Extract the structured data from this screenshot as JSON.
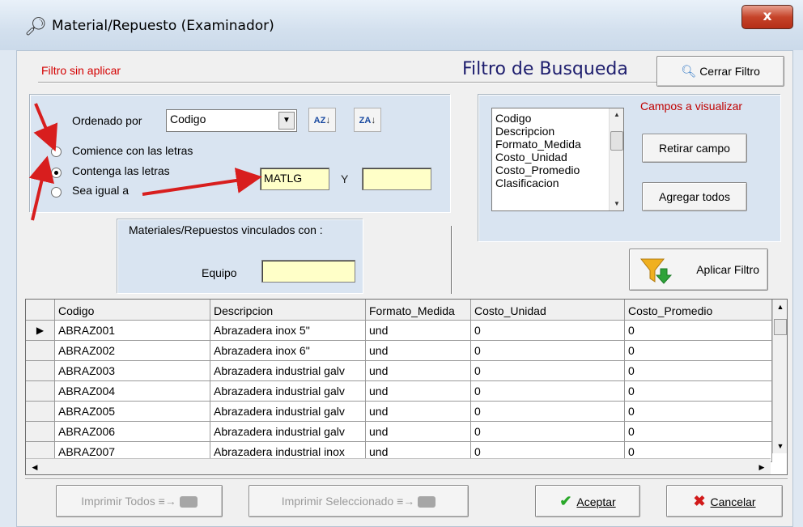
{
  "window": {
    "title": "Material/Repuesto (Examinador)",
    "close_label": "x"
  },
  "filter": {
    "status": "Filtro sin aplicar",
    "heading": "Filtro de Busqueda",
    "close_filter_label": "Cerrar Filtro"
  },
  "order": {
    "label": "Ordenado por",
    "combo_value": "Codigo",
    "sort_asc": {
      "top": "A",
      "bottom": "Z"
    },
    "sort_desc": {
      "top": "Z",
      "bottom": "A"
    },
    "radios": [
      {
        "label": "Comience con las letras",
        "checked": false
      },
      {
        "label": "Contenga las letras",
        "checked": true
      },
      {
        "label": "Sea igual a",
        "checked": false
      }
    ],
    "text1": "MATLG",
    "and_label": "Y",
    "text2": ""
  },
  "linked": {
    "caption": "Materiales/Repuestos vinculados con :",
    "equipo_label": "Equipo",
    "equipo_value": ""
  },
  "fields": {
    "caption": "Campos a visualizar",
    "items": [
      "Codigo",
      "Descripcion",
      "Formato_Medida",
      "Costo_Unidad",
      "Costo_Promedio",
      "Clasificacion"
    ],
    "remove_label": "Retirar campo",
    "add_all_label": "Agregar todos",
    "apply_label": "Aplicar Filtro"
  },
  "grid": {
    "columns": [
      "Codigo",
      "Descripcion",
      "Formato_Medida",
      "Costo_Unidad",
      "Costo_Promedio"
    ],
    "rows": [
      [
        "ABRAZ001",
        "Abrazadera  inox 5''",
        "und",
        "0",
        "0"
      ],
      [
        "ABRAZ002",
        "Abrazadera  inox 6''",
        "und",
        "0",
        "0"
      ],
      [
        "ABRAZ003",
        "Abrazadera industrial galv",
        "und",
        "0",
        "0"
      ],
      [
        "ABRAZ004",
        "Abrazadera industrial galv",
        "und",
        "0",
        "0"
      ],
      [
        "ABRAZ005",
        "Abrazadera industrial galv",
        "und",
        "0",
        "0"
      ],
      [
        "ABRAZ006",
        "Abrazadera industrial galv",
        "und",
        "0",
        "0"
      ],
      [
        "ABRAZ007",
        "Abrazadera industrial inox",
        "und",
        "0",
        "0"
      ]
    ],
    "current_row_marker": "▶"
  },
  "footer": {
    "print_all_label": "Imprimir Todos",
    "print_selected_label": "Imprimir Seleccionado",
    "accept_label": "Aceptar",
    "cancel_label": "Cancelar"
  },
  "colors": {
    "status_red": "#d40000",
    "panel_blue": "#d9e4f1",
    "input_yellow": "#ffffc8",
    "annotation_red": "#d81e1e"
  }
}
